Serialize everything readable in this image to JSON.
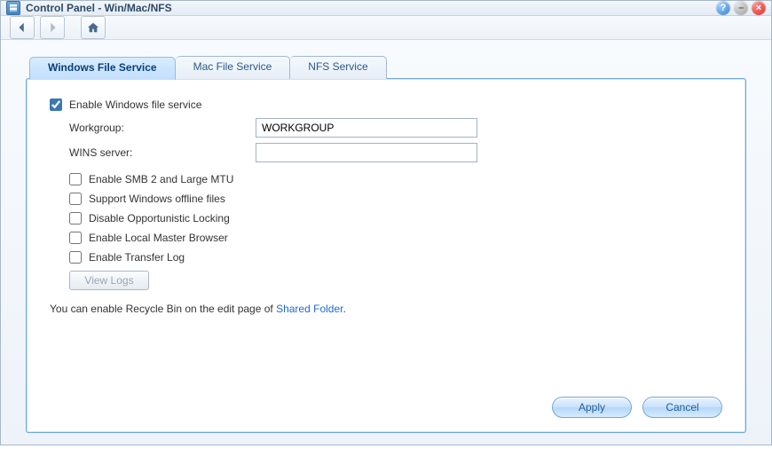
{
  "window": {
    "title": "Control Panel - Win/Mac/NFS"
  },
  "nav": {
    "back_label": "Back",
    "forward_label": "Forward",
    "home_label": "Home"
  },
  "tabs": [
    {
      "label": "Windows File Service",
      "active": true
    },
    {
      "label": "Mac File Service",
      "active": false
    },
    {
      "label": "NFS Service",
      "active": false
    }
  ],
  "form": {
    "enable_label": "Enable Windows file service",
    "enable_checked": true,
    "fields": {
      "workgroup_label": "Workgroup:",
      "workgroup_value": "WORKGROUP",
      "wins_label": "WINS server:",
      "wins_value": ""
    },
    "options": [
      {
        "label": "Enable SMB 2 and Large MTU",
        "checked": false
      },
      {
        "label": "Support Windows offline files",
        "checked": false
      },
      {
        "label": "Disable Opportunistic Locking",
        "checked": false
      },
      {
        "label": "Enable Local Master Browser",
        "checked": false
      },
      {
        "label": "Enable Transfer Log",
        "checked": false
      }
    ],
    "view_logs_label": "View Logs",
    "hint_prefix": "You can enable Recycle Bin on the edit page of ",
    "hint_link": "Shared Folder",
    "hint_suffix": "."
  },
  "buttons": {
    "apply": "Apply",
    "cancel": "Cancel"
  }
}
